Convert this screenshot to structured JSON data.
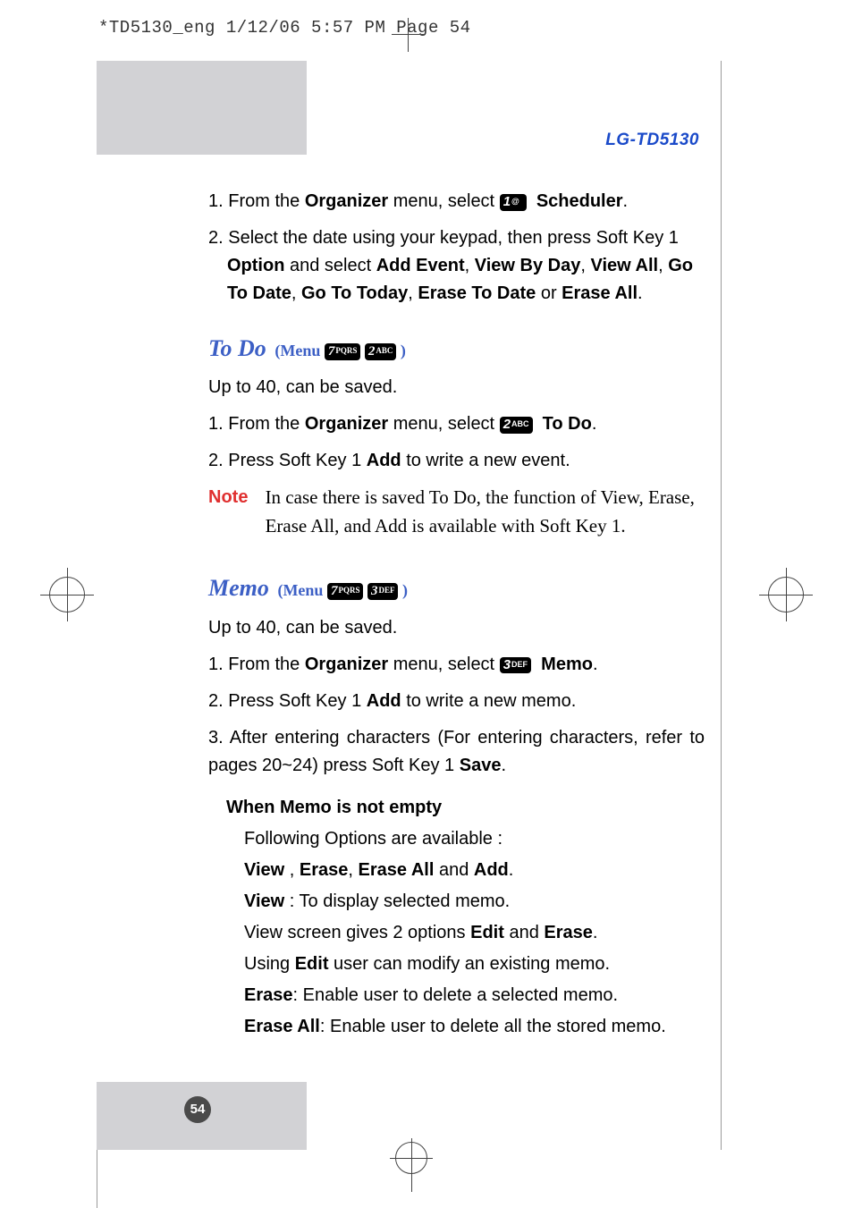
{
  "header": {
    "slug": "*TD5130_eng  1/12/06  5:57 PM  Page 54",
    "model": "LG-TD5130"
  },
  "keys": {
    "k1": "1",
    "k1sub": "@",
    "k2": "2",
    "k2sub": "ABC",
    "k3": "3",
    "k3sub": "DEF",
    "k7": "7",
    "k7sub": "PQRS"
  },
  "intro": {
    "step1_a": "1. From the ",
    "step1_b": "Organizer",
    "step1_c": " menu, select ",
    "step1_d": "Scheduler",
    "step1_e": ".",
    "step2_a": "2. Select the date using your keypad, then press Soft Key 1 ",
    "step2_b": "Option",
    "step2_c": " and select ",
    "step2_d": "Add Event",
    "step2_e": ", ",
    "step2_f": "View By Day",
    "step2_g": ", ",
    "step2_h": "View All",
    "step2_i": ", ",
    "step2_j": "Go To Date",
    "step2_k": ", ",
    "step2_l": "Go To Today",
    "step2_m": ", ",
    "step2_n": "Erase To Date",
    "step2_o": " or ",
    "step2_p": "Erase All",
    "step2_q": "."
  },
  "todo": {
    "title": "To Do",
    "paren_a": "(Menu ",
    "paren_b": ")",
    "intro": "Up to 40, can be saved.",
    "s1_a": "1. From the ",
    "s1_b": "Organizer",
    "s1_c": " menu, select ",
    "s1_d": "To Do",
    "s1_e": ".",
    "s2_a": "2. Press Soft Key 1 ",
    "s2_b": "Add",
    "s2_c": " to write a new event.",
    "note_label": "Note",
    "note_body": "In case there is saved To Do, the function of View, Erase, Erase All, and Add is available with Soft Key 1."
  },
  "memo": {
    "title": "Memo",
    "paren_a": "(Menu ",
    "paren_b": ")",
    "intro": "Up to 40, can be saved.",
    "s1_a": "1. From the ",
    "s1_b": "Organizer",
    "s1_c": " menu, select ",
    "s1_d": "Memo",
    "s1_e": ".",
    "s2_a": "2. Press Soft Key 1 ",
    "s2_b": "Add",
    "s2_c": " to write a new memo.",
    "s3_a": "3. After entering characters (For entering characters, refer to pages 20~24) press Soft Key 1 ",
    "s3_b": "Save",
    "s3_c": ".",
    "subhead": "When Memo is not empty",
    "l1": "Following Options are available :",
    "l2_a": "View",
    "l2_b": " , ",
    "l2_c": "Erase",
    "l2_d": ", ",
    "l2_e": "Erase All",
    "l2_f": " and ",
    "l2_g": "Add",
    "l2_h": ".",
    "l3_a": "View",
    "l3_b": " : To display selected memo.",
    "l4_a": "View screen gives 2 options ",
    "l4_b": "Edit",
    "l4_c": " and ",
    "l4_d": "Erase",
    "l4_e": ".",
    "l5_a": "Using ",
    "l5_b": "Edit",
    "l5_c": " user can modify an existing memo.",
    "l6_a": "Erase",
    "l6_b": ": Enable user to delete a selected memo.",
    "l7_a": "Erase All",
    "l7_b": ": Enable user to delete all the stored memo."
  },
  "page_number": "54"
}
